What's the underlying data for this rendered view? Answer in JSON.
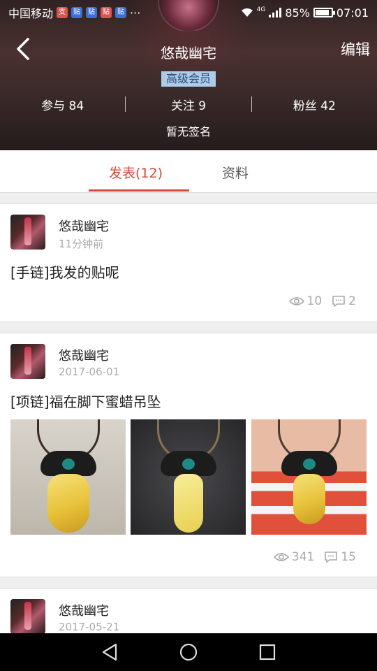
{
  "status_bar": {
    "carrier": "中国移动",
    "app_icons": [
      {
        "glyph": "支",
        "color": "#d9534f"
      },
      {
        "glyph": "贴",
        "color": "#3b6ed8"
      },
      {
        "glyph": "贴",
        "color": "#3b6ed8"
      },
      {
        "glyph": "贴",
        "color": "#d9534f"
      },
      {
        "glyph": "贴",
        "color": "#3b6ed8"
      }
    ],
    "more": "···",
    "network": "4G",
    "battery": "85%",
    "time": "07:01"
  },
  "profile": {
    "name": "悠哉幽宅",
    "edit_label": "编辑",
    "badge": "高级会员",
    "stats": [
      {
        "label": "参与 84"
      },
      {
        "label": "关注 9"
      },
      {
        "label": "粉丝 42"
      }
    ],
    "signature": "暂无签名"
  },
  "tabs": {
    "posts_label": "发表(12)",
    "info_label": "资料"
  },
  "posts": [
    {
      "author": "悠哉幽宅",
      "time": "11分钟前",
      "title": "[手链]我发的贴呢",
      "views": "10",
      "comments": "2"
    },
    {
      "author": "悠哉幽宅",
      "time": "2017-06-01",
      "title": "[项链]福在脚下蜜蜡吊坠",
      "views": "341",
      "comments": "15"
    },
    {
      "author": "悠哉幽宅",
      "time": "2017-05-21"
    }
  ],
  "colors": {
    "accent": "#d8473a",
    "badge_bg": "#aecbe8"
  }
}
